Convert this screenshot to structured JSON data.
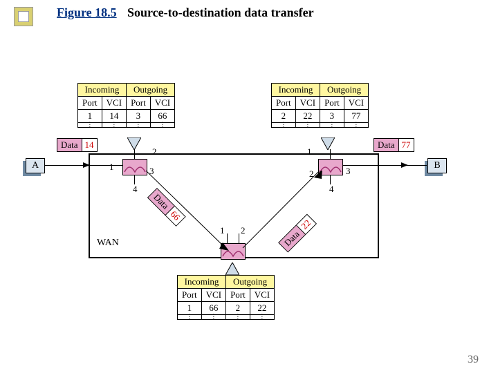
{
  "title": {
    "fig": "Figure 18.5",
    "text": "Source-to-destination data transfer"
  },
  "labels": {
    "wan": "WAN",
    "A": "A",
    "B": "B"
  },
  "tables": {
    "headers": {
      "in": "Incoming",
      "out": "Outgoing",
      "port": "Port",
      "vci": "VCI"
    },
    "left": {
      "in_port": "1",
      "in_vci": "14",
      "out_port": "3",
      "out_vci": "66"
    },
    "right": {
      "in_port": "2",
      "in_vci": "22",
      "out_port": "3",
      "out_vci": "77"
    },
    "bottom": {
      "in_port": "1",
      "in_vci": "66",
      "out_port": "2",
      "out_vci": "22"
    }
  },
  "packets": {
    "a": {
      "label": "Data",
      "vci": "14"
    },
    "b": {
      "label": "Data",
      "vci": "77"
    },
    "l": {
      "label": "Data",
      "vci": "66"
    },
    "r": {
      "label": "Data",
      "vci": "22"
    }
  },
  "ports": {
    "left": {
      "p1": "1",
      "p2": "2",
      "p3": "3",
      "p4": "4"
    },
    "right": {
      "p1": "1",
      "p2": "2",
      "p3": "3",
      "p4": "4"
    },
    "bottom": {
      "p1": "1",
      "p2": "2"
    }
  },
  "pagenum": "39"
}
